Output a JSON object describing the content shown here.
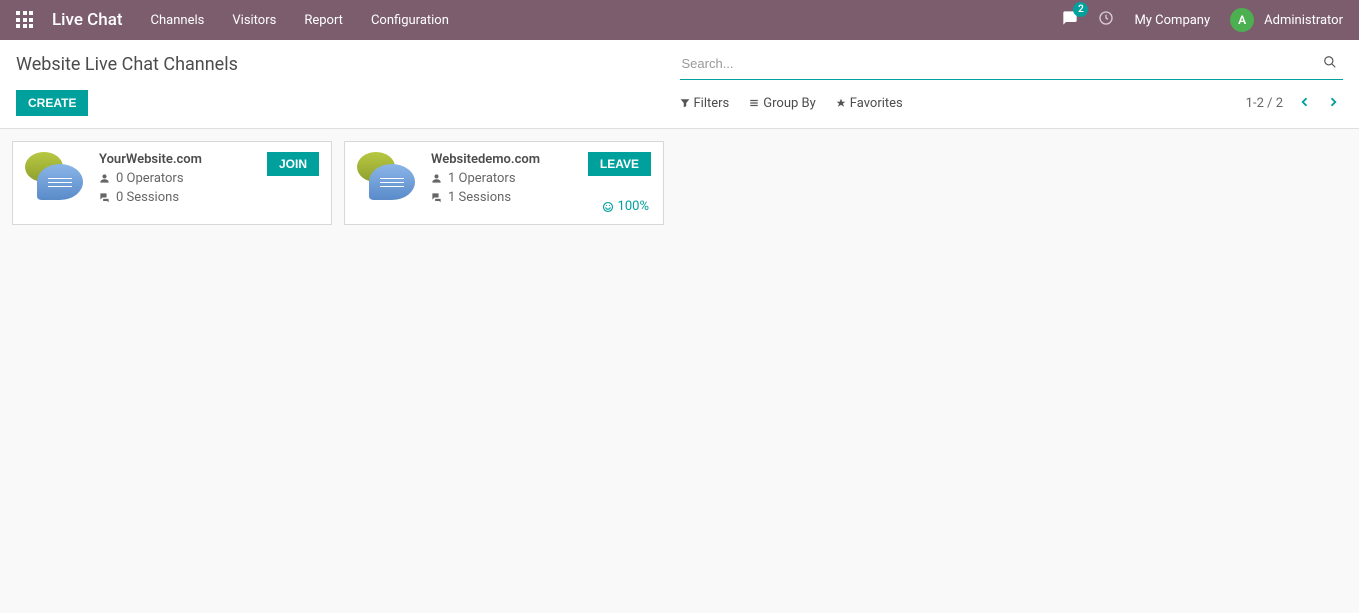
{
  "navbar": {
    "app_title": "Live Chat",
    "menu": [
      "Channels",
      "Visitors",
      "Report",
      "Configuration"
    ],
    "msg_count": "2",
    "company": "My Company",
    "avatar_initial": "A",
    "username": "Administrator"
  },
  "control_panel": {
    "breadcrumb": "Website Live Chat Channels",
    "search_placeholder": "Search...",
    "create_label": "CREATE",
    "filters_label": "Filters",
    "groupby_label": "Group By",
    "favorites_label": "Favorites",
    "pager_text": "1-2 / 2"
  },
  "cards": [
    {
      "title": "YourWebsite.com",
      "operators": "0 Operators",
      "sessions": "0 Sessions",
      "action": "JOIN",
      "rating": ""
    },
    {
      "title": "Websitedemo.com",
      "operators": "1 Operators",
      "sessions": "1 Sessions",
      "action": "LEAVE",
      "rating": "100%"
    }
  ]
}
